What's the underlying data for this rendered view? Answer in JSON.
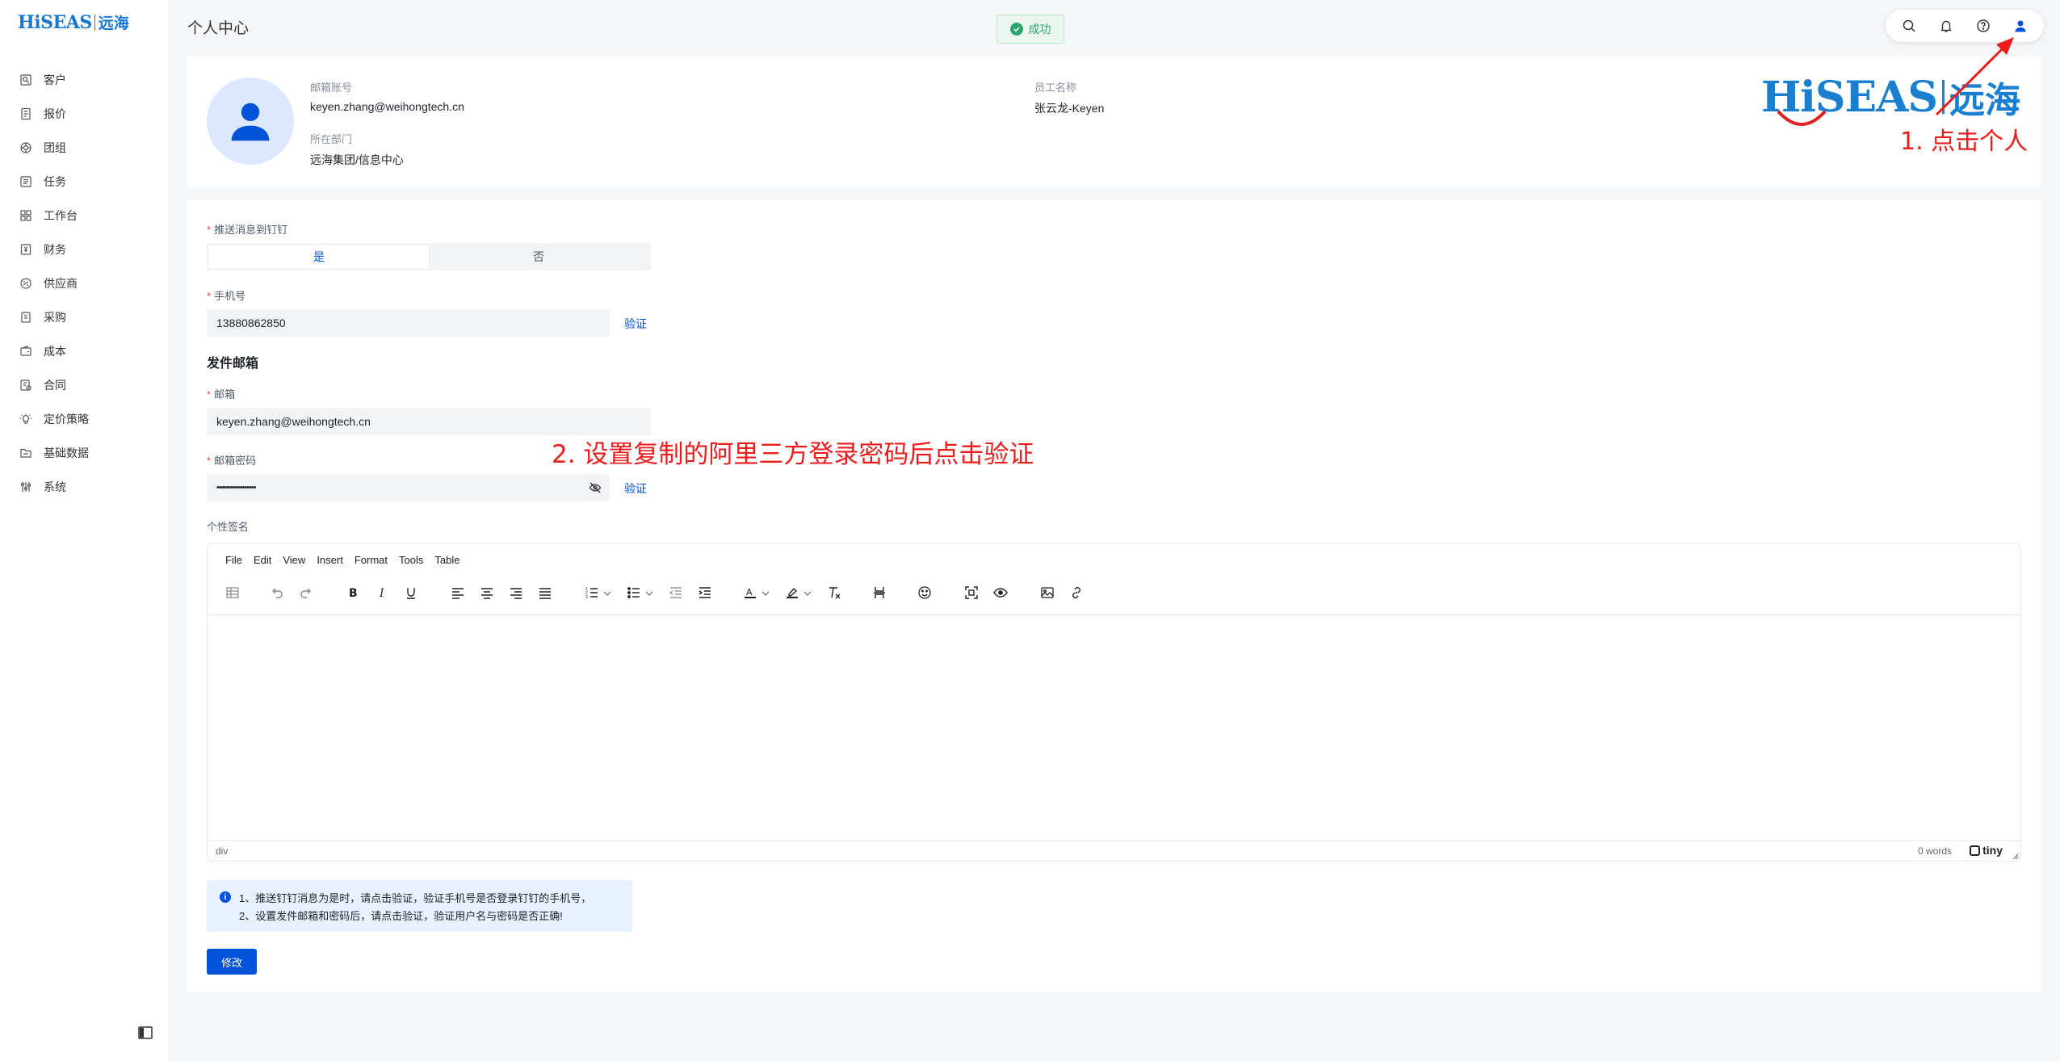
{
  "app": {
    "logo_text": "HiSEAS",
    "logo_cn": "远海"
  },
  "sidebar": {
    "items": [
      {
        "label": "客户",
        "icon": "customer-icon"
      },
      {
        "label": "报价",
        "icon": "quote-icon"
      },
      {
        "label": "团组",
        "icon": "group-icon"
      },
      {
        "label": "任务",
        "icon": "task-icon"
      },
      {
        "label": "工作台",
        "icon": "workbench-icon"
      },
      {
        "label": "财务",
        "icon": "finance-icon"
      },
      {
        "label": "供应商",
        "icon": "supplier-icon"
      },
      {
        "label": "采购",
        "icon": "purchase-icon"
      },
      {
        "label": "成本",
        "icon": "wallet-icon"
      },
      {
        "label": "合同",
        "icon": "contract-icon"
      },
      {
        "label": "定价策略",
        "icon": "bulb-icon"
      },
      {
        "label": "基础数据",
        "icon": "folder-icon"
      },
      {
        "label": "系统",
        "icon": "sliders-icon"
      }
    ]
  },
  "header": {
    "title": "个人中心",
    "toast": "成功"
  },
  "profile": {
    "email_label": "邮箱账号",
    "email_value": "keyen.zhang@weihongtech.cn",
    "dept_label": "所在部门",
    "dept_value": "远海集团/信息中心",
    "name_label": "员工名称",
    "name_value": "张云龙-Keyen"
  },
  "annotations": {
    "step1": "1. 点击个人",
    "step2": "2. 设置复制的阿里三方登录密码后点击验证"
  },
  "form": {
    "push_label": "推送消息到钉钉",
    "push_options": [
      "是",
      "否"
    ],
    "push_selected": "是",
    "phone_label": "手机号",
    "phone_value": "13880862850",
    "verify_label": "验证",
    "section_title": "发件邮箱",
    "mail_label": "邮箱",
    "mail_value": "keyen.zhang@weihongtech.cn",
    "mail_pwd_label": "邮箱密码",
    "mail_pwd_value": "•••••••••••••••••",
    "signature_label": "个性签名",
    "submit_label": "修改"
  },
  "editor": {
    "menus": [
      "File",
      "Edit",
      "View",
      "Insert",
      "Format",
      "Tools",
      "Table"
    ],
    "path": "div",
    "word_count": "0 words",
    "brand": "tiny"
  },
  "notice": {
    "line1": "1、推送钉钉消息为是时，请点击验证，验证手机号是否登录钉钉的手机号，",
    "line2": "2、设置发件邮箱和密码后，请点击验证，验证用户名与密码是否正确!"
  },
  "colors": {
    "primary": "#0052d9",
    "brand_blue": "#1976d2",
    "annotation_red": "#ea1c1c",
    "success": "#2ba471"
  }
}
